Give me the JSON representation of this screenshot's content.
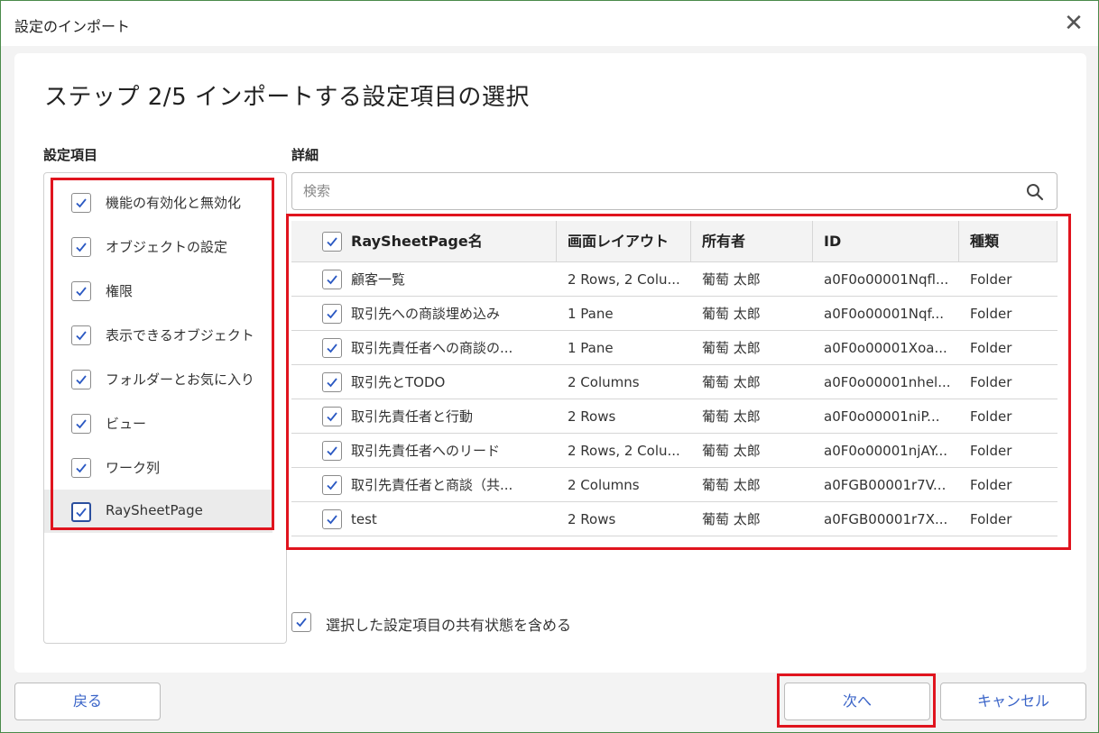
{
  "window": {
    "title": "設定のインポート"
  },
  "step_title": "ステップ 2/5 インポートする設定項目の選択",
  "left": {
    "section_label": "設定項目",
    "items": [
      {
        "label": "機能の有効化と無効化",
        "checked": true
      },
      {
        "label": "オブジェクトの設定",
        "checked": true
      },
      {
        "label": "権限",
        "checked": true
      },
      {
        "label": "表示できるオブジェクト",
        "checked": true
      },
      {
        "label": "フォルダーとお気に入り",
        "checked": true
      },
      {
        "label": "ビュー",
        "checked": true
      },
      {
        "label": "ワーク列",
        "checked": true
      },
      {
        "label": "RaySheetPage",
        "checked": true,
        "selected": true
      }
    ]
  },
  "detail": {
    "section_label": "詳細",
    "search": {
      "placeholder": "検索",
      "value": ""
    },
    "columns": [
      "RaySheetPage名",
      "画面レイアウト",
      "所有者",
      "ID",
      "種類"
    ],
    "rows": [
      [
        "顧客一覧",
        "2 Rows, 2 Colu...",
        "葡萄 太郎",
        "a0F0o00001Nqfl...",
        "Folder"
      ],
      [
        "取引先への商談埋め込み",
        "1 Pane",
        "葡萄 太郎",
        "a0F0o00001Nqf...",
        "Folder"
      ],
      [
        "取引先責任者への商談の...",
        "1 Pane",
        "葡萄 太郎",
        "a0F0o00001Xoa...",
        "Folder"
      ],
      [
        "取引先とTODO",
        "2 Columns",
        "葡萄 太郎",
        "a0F0o00001nhel...",
        "Folder"
      ],
      [
        "取引先責任者と行動",
        "2 Rows",
        "葡萄 太郎",
        "a0F0o00001niP...",
        "Folder"
      ],
      [
        "取引先責任者へのリード",
        "2 Rows, 2 Colu...",
        "葡萄 太郎",
        "a0F0o00001njAY...",
        "Folder"
      ],
      [
        "取引先責任者と商談（共...",
        "2 Columns",
        "葡萄 太郎",
        "a0FGB00001r7V...",
        "Folder"
      ],
      [
        "test",
        "2 Rows",
        "葡萄 太郎",
        "a0FGB00001r7X...",
        "Folder"
      ]
    ]
  },
  "include_share_label": "選択した設定項目の共有状態を含める",
  "buttons": {
    "back": "戻る",
    "next": "次へ",
    "cancel": "キャンセル"
  },
  "colors": {
    "accent": "#3a64c8",
    "highlight": "#e0141e",
    "check": "#2b59c3"
  }
}
